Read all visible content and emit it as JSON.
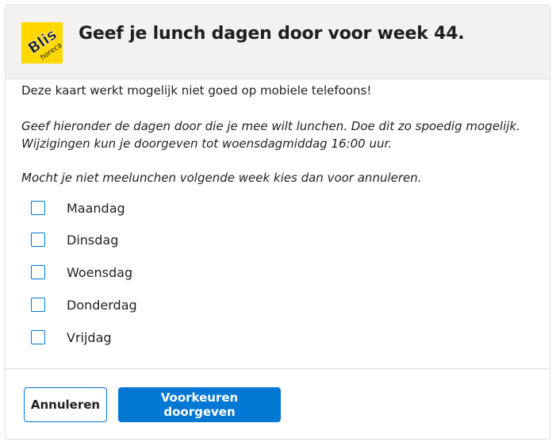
{
  "header": {
    "logo_text": "Blis",
    "logo_sub": "horeca",
    "title": "Geef je lunch dagen door voor week 44."
  },
  "body": {
    "warning": "Deze kaart werkt mogelijk niet goed op mobiele telefoons!",
    "instructions_line1": "Geef hieronder de dagen door die je mee wilt lunchen. Doe dit zo spoedig mogelijk.",
    "instructions_line2": "Wijzigingen kun je doorgeven tot woensdagmiddag 16:00 uur.",
    "cancel_note": "Mocht je niet meelunchen volgende week kies dan voor annuleren."
  },
  "days": [
    {
      "label": "Maandag",
      "checked": false
    },
    {
      "label": "Dinsdag",
      "checked": false
    },
    {
      "label": "Woensdag",
      "checked": false
    },
    {
      "label": "Donderdag",
      "checked": false
    },
    {
      "label": "Vrijdag",
      "checked": false
    }
  ],
  "footer": {
    "cancel_label": "Annuleren",
    "submit_label": "Voorkeuren doorgeven"
  },
  "colors": {
    "accent": "#0078d4",
    "header_bg": "#f3f2f1",
    "logo_bg": "#ffd800"
  }
}
